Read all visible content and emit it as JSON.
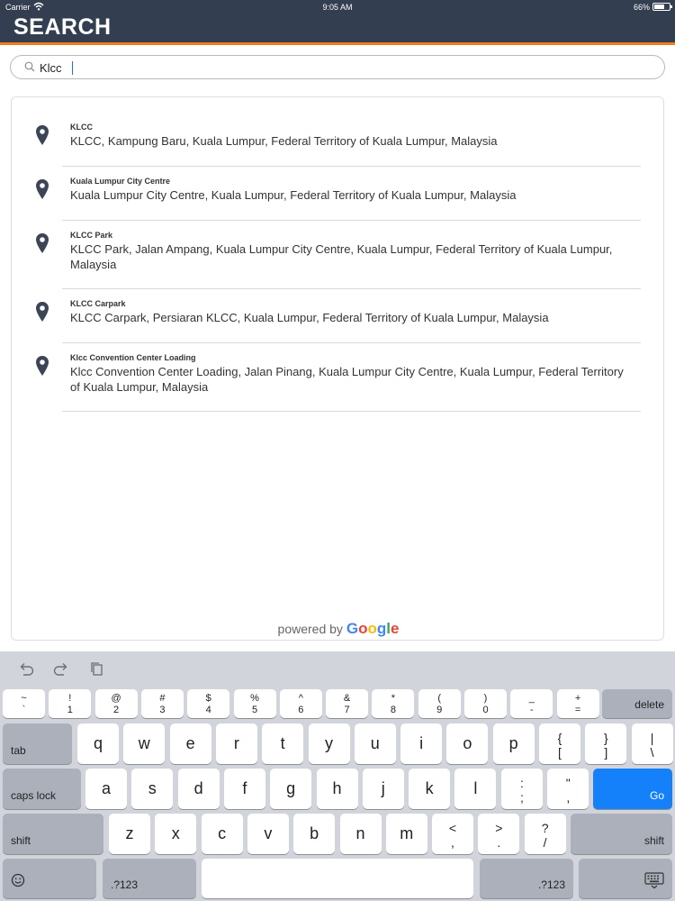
{
  "status_bar": {
    "carrier": "Carrier",
    "time": "9:05 AM",
    "battery": "66%",
    "battery_level": 0.66
  },
  "header": {
    "title": "SEARCH",
    "bg_color": "#333e50",
    "accent_color": "#f07c1b"
  },
  "search": {
    "value": "Klcc"
  },
  "results": [
    {
      "title": "KLCC",
      "description": "KLCC, Kampung Baru, Kuala Lumpur, Federal Territory of Kuala Lumpur, Malaysia"
    },
    {
      "title": "Kuala Lumpur City Centre",
      "description": "Kuala Lumpur City Centre, Kuala Lumpur, Federal Territory of Kuala Lumpur, Malaysia"
    },
    {
      "title": "KLCC Park",
      "description": "KLCC Park, Jalan Ampang, Kuala Lumpur City Centre, Kuala Lumpur, Federal Territory of Kuala Lumpur, Malaysia"
    },
    {
      "title": "KLCC Carpark",
      "description": "KLCC Carpark, Persiaran KLCC, Kuala Lumpur, Federal Territory of Kuala Lumpur, Malaysia"
    },
    {
      "title": "Klcc Convention Center Loading",
      "description": "Klcc Convention Center Loading, Jalan Pinang, Kuala Lumpur City Centre, Kuala Lumpur, Federal Territory of Kuala Lumpur, Malaysia"
    }
  ],
  "attribution": {
    "prefix": "powered by",
    "brand": "Google"
  },
  "keyboard": {
    "toolbar": [
      "undo-icon",
      "redo-icon",
      "paste-icon"
    ],
    "row1": [
      {
        "top": "~",
        "bot": "`"
      },
      {
        "top": "!",
        "bot": "1"
      },
      {
        "top": "@",
        "bot": "2"
      },
      {
        "top": "#",
        "bot": "3"
      },
      {
        "top": "$",
        "bot": "4"
      },
      {
        "top": "%",
        "bot": "5"
      },
      {
        "top": "^",
        "bot": "6"
      },
      {
        "top": "&",
        "bot": "7"
      },
      {
        "top": "*",
        "bot": "8"
      },
      {
        "top": "(",
        "bot": "9"
      },
      {
        "top": ")",
        "bot": "0"
      },
      {
        "top": "_",
        "bot": "-"
      },
      {
        "top": "+",
        "bot": "="
      }
    ],
    "delete_label": "delete",
    "tab_label": "tab",
    "row2": [
      "q",
      "w",
      "e",
      "r",
      "t",
      "y",
      "u",
      "i",
      "o",
      "p"
    ],
    "row2_symbols": [
      {
        "top": "{",
        "bot": "["
      },
      {
        "top": "}",
        "bot": "]"
      },
      {
        "top": "|",
        "bot": "\\"
      }
    ],
    "caps_label": "caps lock",
    "row3": [
      "a",
      "s",
      "d",
      "f",
      "g",
      "h",
      "j",
      "k",
      "l"
    ],
    "row3_symbols": [
      {
        "top": ":",
        "bot": ";"
      },
      {
        "top": "\"",
        "bot": ","
      }
    ],
    "go_label": "Go",
    "shift_label": "shift",
    "row4": [
      "z",
      "x",
      "c",
      "v",
      "b",
      "n",
      "m"
    ],
    "row4_symbols": [
      {
        "top": "<",
        "bot": ","
      },
      {
        "top": ">",
        "bot": "."
      },
      {
        "top": "?",
        "bot": "/"
      }
    ],
    "numbers_label": ".?123",
    "emoji_icon": "emoji-icon",
    "hide_keyboard_icon": "keyboard-hide-icon"
  }
}
